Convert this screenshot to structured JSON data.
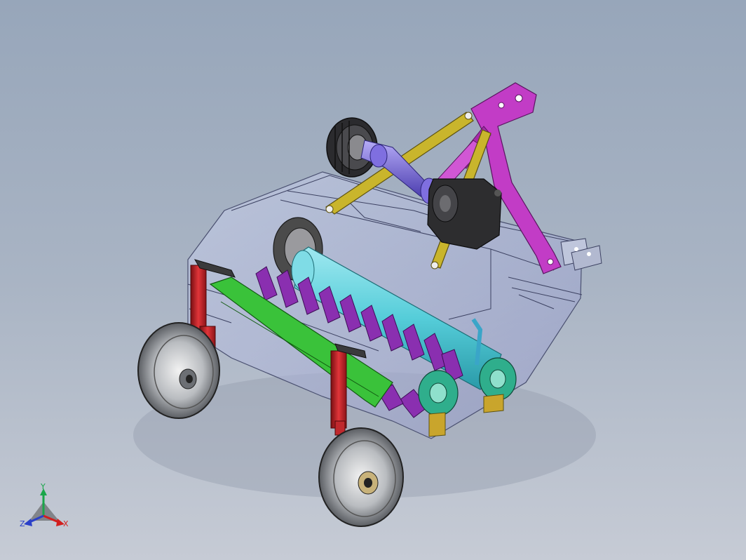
{
  "view": {
    "background_top": "#97a6ba",
    "background_bottom": "#c6cbd5"
  },
  "triad": {
    "y_label": "Y",
    "z_label": "Z",
    "x_label": "X",
    "y_color": "#1aa64a",
    "z_color": "#2b40c8",
    "x_color": "#d21e1e"
  },
  "model": {
    "frame_color": "#c9d1ea",
    "hitch_color": "#c23cc6",
    "link_color": "#c9b52c",
    "shaft_color": "#7f6fe0",
    "rotor_color": "#5fd0dc",
    "blade_color": "#8a2fb0",
    "stand_color": "#c0282d",
    "rail_color": "#3ac23a",
    "bearing_color": "#2fae8c",
    "wheel_color": "#9aa0a6",
    "gearbox_color": "#2d2d2f"
  }
}
